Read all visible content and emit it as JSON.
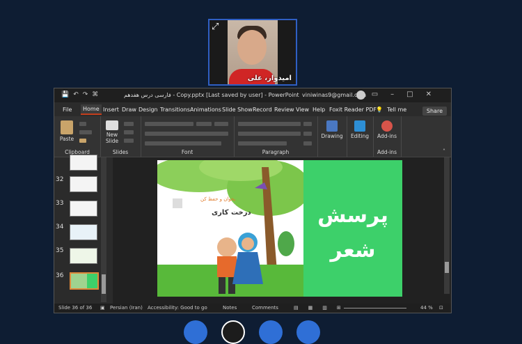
{
  "camera": {
    "participant_name": "امیدوار، علی",
    "expand_icon": "expand-icon"
  },
  "powerpoint": {
    "title": "فارسی درس هفدهم - Copy.pptx [Last saved by user] - PowerPoint",
    "account": "viniwinas9@gmail.com",
    "tabs": [
      "File",
      "Home",
      "Insert",
      "Draw",
      "Design",
      "Transitions",
      "Animations",
      "Slide Show",
      "Record",
      "Review",
      "View",
      "Help",
      "Foxit Reader PDF"
    ],
    "active_tab": "Home",
    "tell_me": "Tell me",
    "share": "Share",
    "ribbon": {
      "paste": "Paste",
      "new_slide": "New Slide",
      "drawing": "Drawing",
      "editing": "Editing",
      "addins": "Add-ins",
      "groups": {
        "clipboard": "Clipboard",
        "slides": "Slides",
        "font": "Font",
        "paragraph": "Paragraph",
        "addins": "Add-ins"
      }
    },
    "thumbnails": [
      "32",
      "33",
      "34",
      "35",
      "36"
    ],
    "slide": {
      "title_line1": "پرسش",
      "title_line2": "شعر",
      "subtitle": "درخت کاری",
      "label": "بخوان و حفظ کن"
    },
    "status": {
      "slide_count": "Slide 36 of 36",
      "language": "Persian (Iran)",
      "accessibility": "Accessibility: Good to go",
      "notes": "Notes",
      "comments": "Comments",
      "zoom": "44 %"
    },
    "colors": {
      "slide_green": "#3dd06a",
      "accent": "#c43e1c"
    }
  }
}
